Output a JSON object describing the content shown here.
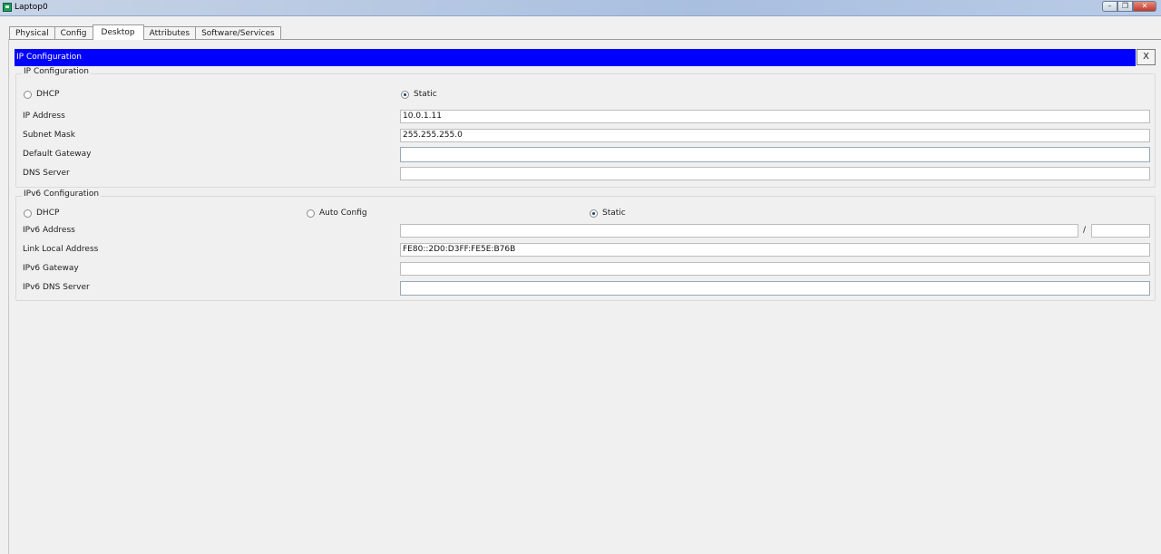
{
  "window": {
    "title": "Laptop0"
  },
  "tabs": [
    "Physical",
    "Config",
    "Desktop",
    "Attributes",
    "Software/Services"
  ],
  "active_tab": "Desktop",
  "panel": {
    "header": "IP Configuration",
    "close_label": "X"
  },
  "ipv4": {
    "title": "IP Configuration",
    "dhcp_label": "DHCP",
    "static_label": "Static",
    "mode": "Static",
    "ip_address_label": "IP Address",
    "ip_address": "10.0.1.11",
    "subnet_mask_label": "Subnet Mask",
    "subnet_mask": "255.255.255.0",
    "default_gateway_label": "Default Gateway",
    "default_gateway": "",
    "dns_server_label": "DNS Server",
    "dns_server": ""
  },
  "ipv6": {
    "title": "IPv6 Configuration",
    "dhcp_label": "DHCP",
    "auto_config_label": "Auto Config",
    "static_label": "Static",
    "mode": "Static",
    "address_label": "IPv6 Address",
    "address": "",
    "prefix_separator": "/",
    "prefix_length": "",
    "link_local_label": "Link Local Address",
    "link_local": "FE80::2D0:D3FF:FE5E:B76B",
    "gateway_label": "IPv6 Gateway",
    "gateway": "",
    "dns_server_label": "IPv6 DNS Server",
    "dns_server": ""
  },
  "colors": {
    "header_bar": "#0000ff",
    "background": "#f0f0f0"
  }
}
